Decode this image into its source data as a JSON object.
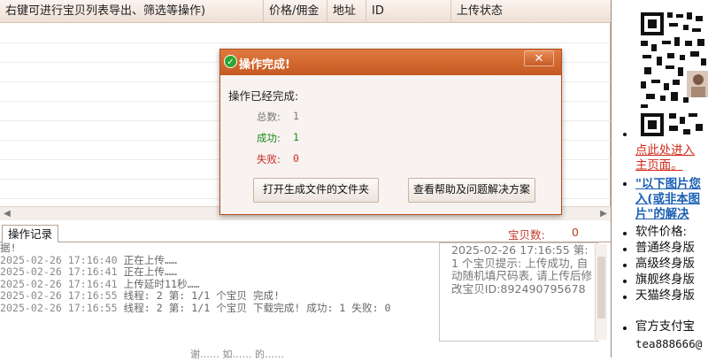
{
  "list": {
    "columns": [
      {
        "label": "右键可进行宝贝列表导出、筛选等操作)"
      },
      {
        "label": "价格/佣金"
      },
      {
        "label": "地址"
      },
      {
        "label": "ID"
      },
      {
        "label": "上传状态"
      }
    ]
  },
  "log": {
    "tab_label": "操作记录",
    "count_label": "宝贝数:",
    "count_value": "0",
    "lines": [
      {
        "time": "",
        "text": "据!"
      },
      {
        "time": "2025-02-26 17:16:40",
        "text": "正在上传……"
      },
      {
        "time": "2025-02-26 17:16:41",
        "text": "正在上传……"
      },
      {
        "time": "2025-02-26 17:16:41",
        "text": "上传延时11秒……"
      },
      {
        "time": "2025-02-26 17:16:55",
        "text": "线程: 2 第: 1/1 个宝贝 完成!"
      },
      {
        "time": "2025-02-26 17:16:55",
        "text": "线程: 2 第: 1/1 个宝贝 下载完成! 成功: 1 失败: 0"
      }
    ],
    "detail_text": "2025-02-26 17:16:55 第: 1 个宝贝提示: 上传成功, 自动随机填尺码表, 请上传后修改宝贝ID:892490795678",
    "footer_hint": "谢…… 如…… 的……"
  },
  "sidebar": {
    "items": [
      {
        "text": "点此处进入主页面。",
        "style": "red"
      },
      {
        "text": "\"以下图片您入(或非本图片\"的解决",
        "style": "link"
      },
      {
        "text": "软件价格:",
        "style": "plain"
      },
      {
        "text": "普通终身版",
        "style": "plain"
      },
      {
        "text": "高级终身版",
        "style": "plain"
      },
      {
        "text": "旗舰终身版",
        "style": "plain"
      },
      {
        "text": "天猫终身版",
        "style": "plain"
      },
      {
        "text": "官方支付宝",
        "style": "plain"
      },
      {
        "text": "tea888666@",
        "style": "plain"
      }
    ]
  },
  "dialog": {
    "title": "操作完成!",
    "close_label": "✕",
    "message": "操作已经完成:",
    "total_label": "总数:",
    "total_value": "1",
    "success_label": "成功:",
    "success_value": "1",
    "fail_label": "失败:",
    "fail_value": "0",
    "open_folder_button": "打开生成文件的文件夹",
    "help_button": "查看帮助及问题解决方案"
  },
  "colors": {
    "accent": "#c55a22",
    "success": "#1a8a1a",
    "fail": "#c62828",
    "link": "#1a5fb4"
  }
}
